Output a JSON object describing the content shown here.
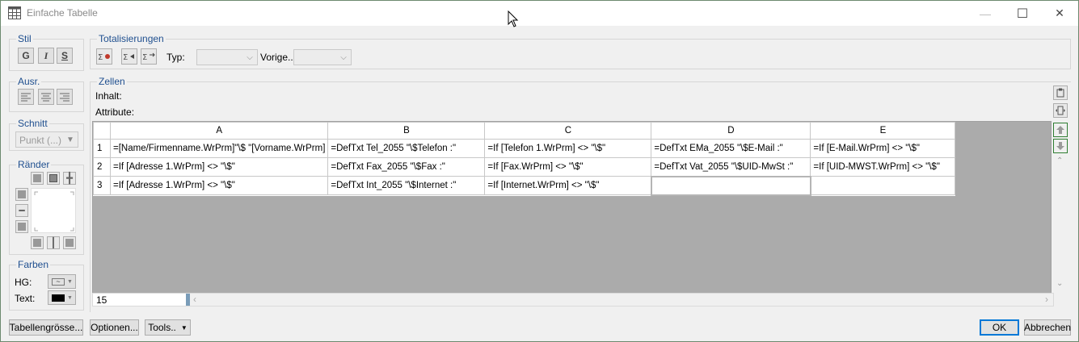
{
  "window": {
    "title": "Einfache Tabelle",
    "minimize_glyph": "—",
    "maximize_glyph": "☐",
    "close_glyph": "✕"
  },
  "stil": {
    "legend": "Stil",
    "bold": "G",
    "italic": "I",
    "strike": "S"
  },
  "ausr": {
    "legend": "Ausr."
  },
  "schnitt": {
    "legend": "Schnitt",
    "value": "Punkt (...)"
  },
  "raender": {
    "legend": "Ränder"
  },
  "farben": {
    "legend": "Farben",
    "hg_label": "HG:",
    "text_label": "Text:",
    "hg_glyph": "~"
  },
  "totalisierungen": {
    "legend": "Totalisierungen",
    "typ_label": "Typ:",
    "vorige_label": "Vorige..",
    "typ_value": "",
    "vorige_value": ""
  },
  "zellen": {
    "legend": "Zellen",
    "inhalt_label": "Inhalt:",
    "attribute_label": "Attribute:"
  },
  "grid": {
    "columns": [
      "A",
      "B",
      "C",
      "D",
      "E"
    ],
    "rows": [
      {
        "num": "1",
        "cells": [
          "=[Name/Firmenname.WrPrm]\"\\$ \"[Vorname.WrPrm]",
          "=DefTxt Tel_2055 \"\\$Telefon :\"",
          "=If [Telefon 1.WrPrm] <> \"\\$\"",
          "=DefTxt EMa_2055 \"\\$E-Mail :\"",
          "=If [E-Mail.WrPrm] <> \"\\$\""
        ]
      },
      {
        "num": "2",
        "cells": [
          "=If [Adresse 1.WrPrm] <> \"\\$\"",
          "=DefTxt Fax_2055 \"\\$Fax :\"",
          "=If [Fax.WrPrm] <> \"\\$\"",
          "=DefTxt Vat_2055 \"\\$UID-MwSt :\"",
          "=If [UID-MWST.WrPrm] <> \"\\$\""
        ]
      },
      {
        "num": "3",
        "cells": [
          "=If [Adresse 1.WrPrm] <> \"\\$\"",
          "=DefTxt Int_2055 \"\\$Internet :\"",
          "=If [Internet.WrPrm] <> \"\\$\"",
          "",
          ""
        ]
      }
    ]
  },
  "bottom_input": {
    "value": "15"
  },
  "buttons": {
    "tabellengroesse": "Tabellengrösse...",
    "optionen": "Optionen...",
    "tools": "Tools..",
    "ok": "OK",
    "abbrechen": "Abbrechen"
  },
  "colors": {
    "accent": "#0078d7",
    "legend_text": "#1f4f8f",
    "scroll_green": "#2e7d32"
  }
}
